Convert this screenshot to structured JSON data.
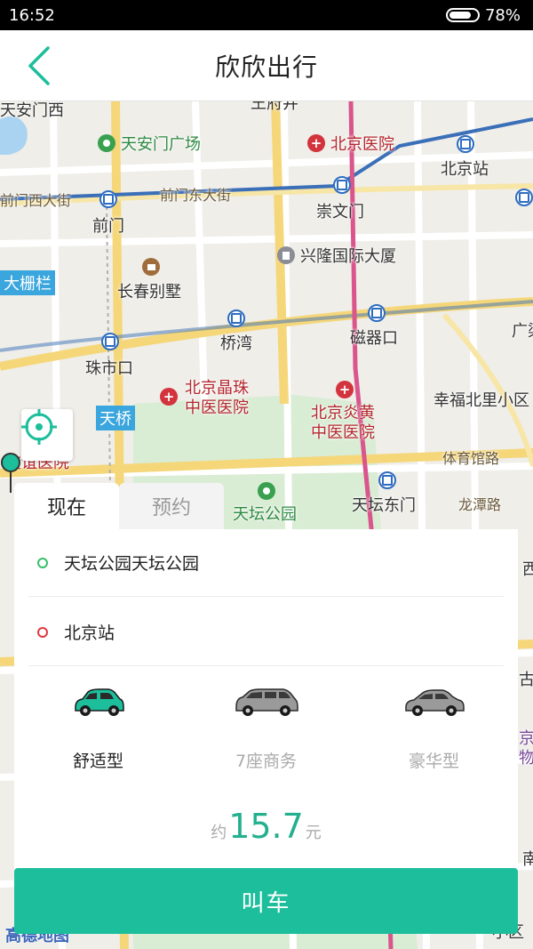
{
  "status_bar": {
    "time": "16:52",
    "battery": "78%"
  },
  "header": {
    "title": "欣欣出行"
  },
  "map": {
    "labels": {
      "tiananmen_west": "天安门西",
      "tiananmen_square": "天安门广场",
      "wangfujing": "王府井",
      "beijing_hospital": "北京医院",
      "beijing_station": "北京站",
      "qianmen_west_st": "前门西大街",
      "qianmen_east_st": "前门东大街",
      "chongwenmen": "崇文门",
      "qianmen": "前门",
      "xinglong": "兴隆国际大厦",
      "dashilan": "大栅栏",
      "changchun": "长春别墅",
      "qiaowan": "桥湾",
      "ciqikou": "磁器口",
      "guangqu": "广渠",
      "zhushikou": "珠市口",
      "jingzhu_hosp": "北京晶珠\n中医医院",
      "yanhuang_hosp": "北京炎黄\n中医医院",
      "xingfu": "幸福北里小区",
      "tianqiao": "天桥",
      "youyi": "友谊医院",
      "tiyuguan": "体育馆路",
      "tiantan_park": "天坛公园",
      "tiantan_east": "天坛东门",
      "longtan": "龙潭路",
      "nan": "南",
      "xiqi": "西湖",
      "gu": "古园",
      "jingwu": "京\n物",
      "xiao": "小区",
      "gaode": "高德地图"
    }
  },
  "booking": {
    "tabs": [
      {
        "label": "现在"
      },
      {
        "label": "预约"
      }
    ],
    "origin": "天坛公园天坛公园",
    "destination": "北京站",
    "car_types": [
      {
        "label": "舒适型",
        "selected": true
      },
      {
        "label": "7座商务",
        "selected": false
      },
      {
        "label": "豪华型",
        "selected": false
      }
    ],
    "price_prefix": "约",
    "price_value": "15.7",
    "price_unit": "元",
    "call_button": "叫车"
  },
  "colors": {
    "accent": "#1dbe9b",
    "price": "#23b08e",
    "origin_dot": "#33c06a",
    "dest_dot": "#e0383e"
  }
}
